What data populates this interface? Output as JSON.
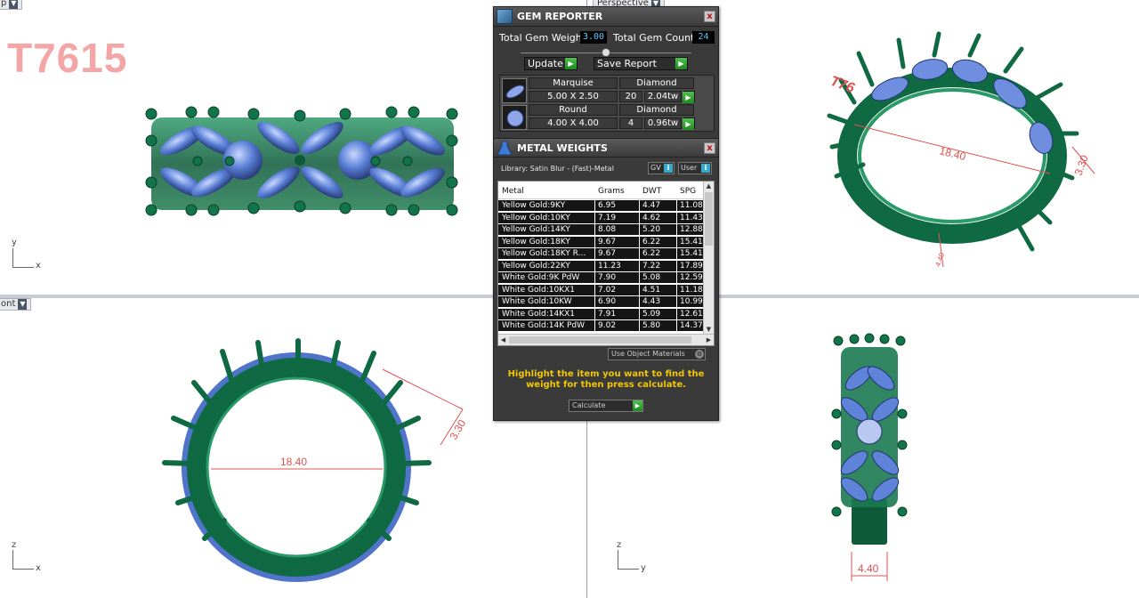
{
  "viewports": {
    "top_left_tab": "p",
    "top_center_tab": "Perspective",
    "bottom_left_tab": "ont",
    "part_code": "T7615",
    "axes": {
      "top_left": {
        "v": "y",
        "h": "x"
      },
      "bottom_left": {
        "v": "z",
        "h": "x"
      },
      "bottom_right": {
        "v": "z",
        "h": "y"
      }
    },
    "dimensions": {
      "inner_diameter": "18.40",
      "band_width": "3.30",
      "shank_width": "4.40",
      "perspective_diameter": "18.40",
      "perspective_band_width": "3.30",
      "perspective_shank": "4.40",
      "perspective_code": "T76"
    }
  },
  "gem_reporter": {
    "title": "GEM REPORTER",
    "close": "x",
    "total_weight_label": "Total Gem Weight",
    "total_weight_value": "3.00",
    "total_count_label": "Total Gem Count",
    "total_count_value": "24",
    "update_label": "Update",
    "save_report_label": "Save Report",
    "gems": [
      {
        "shape": "Marquise",
        "size": "5.00 X 2.50",
        "material": "Diamond",
        "count": "20",
        "weight": "2.04tw"
      },
      {
        "shape": "Round",
        "size": "4.00 X 4.00",
        "material": "Diamond",
        "count": "4",
        "weight": "0.96tw"
      }
    ]
  },
  "metal_weights": {
    "title": "METAL WEIGHTS",
    "close": "x",
    "library_label": "Library: Satin Blur - (Fast)-Metal",
    "gv_label": "GV",
    "user_label": "User",
    "columns": [
      "Metal",
      "Grams",
      "DWT",
      "SPG"
    ],
    "rows": [
      [
        "Yellow Gold:9KY",
        "6.95",
        "4.47",
        "11.08"
      ],
      [
        "Yellow Gold:10KY",
        "7.19",
        "4.62",
        "11.43"
      ],
      [
        "Yellow Gold:14KY",
        "8.08",
        "5.20",
        "12.88"
      ],
      [
        "Yellow Gold:18KY",
        "9.67",
        "6.22",
        "15.41"
      ],
      [
        "Yellow Gold:18KY R...",
        "9.67",
        "6.22",
        "15.41"
      ],
      [
        "Yellow Gold:22KY",
        "11.23",
        "7.22",
        "17.89"
      ],
      [
        "White Gold:9K PdW",
        "7.90",
        "5.08",
        "12.59"
      ],
      [
        "White Gold:10KX1",
        "7.02",
        "4.51",
        "11.18"
      ],
      [
        "White Gold:10KW",
        "6.90",
        "4.43",
        "10.99"
      ],
      [
        "White Gold:14KX1",
        "7.91",
        "5.09",
        "12.61"
      ],
      [
        "White Gold:14K PdW",
        "9.02",
        "5.80",
        "14.37"
      ]
    ],
    "use_object_materials": "Use Object Materials",
    "hint": "Highlight the item you want to find the weight for then press calculate.",
    "calculate_label": "Calculate"
  }
}
